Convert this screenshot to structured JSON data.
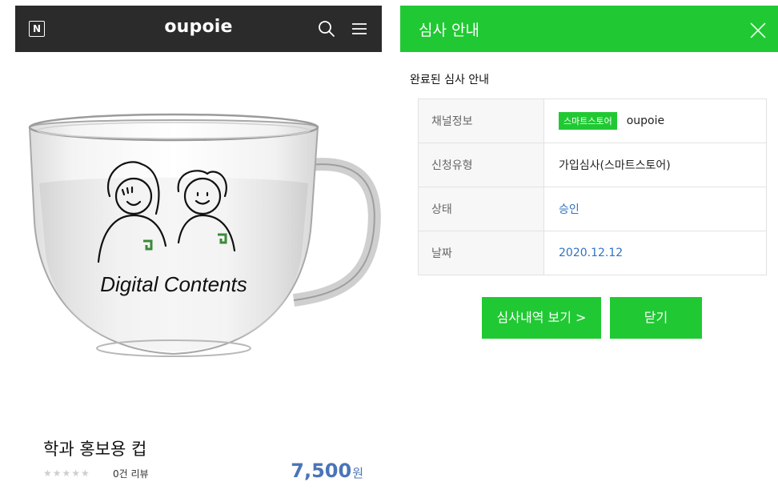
{
  "store": {
    "logo_letter": "N",
    "title": "oupoie"
  },
  "product": {
    "mug_text": "Digital Contents",
    "mug_logo": "G",
    "name": "학과 홍보용 컵",
    "rating_stars": "★★★★★",
    "rating_value": 0,
    "review_count_label": "0건 리뷰",
    "price": "7,500",
    "currency": "원"
  },
  "dialog": {
    "title": "심사 안내",
    "section_label": "완료된 심사 안내",
    "rows": [
      {
        "key": "채널정보",
        "badge": "스마트스토어",
        "value": "oupoie"
      },
      {
        "key": "신청유형",
        "value": "가입심사(스마트스토어)"
      },
      {
        "key": "상태",
        "value": "승인"
      },
      {
        "key": "날짜",
        "value": "2020.12.12"
      }
    ],
    "history_button": "심사내역 보기 >",
    "close_button": "닫기"
  },
  "colors": {
    "accent_green": "#20c933",
    "top_bar": "#2b2b2b",
    "price_blue": "#4b74b8",
    "link_blue": "#2f73c0"
  }
}
